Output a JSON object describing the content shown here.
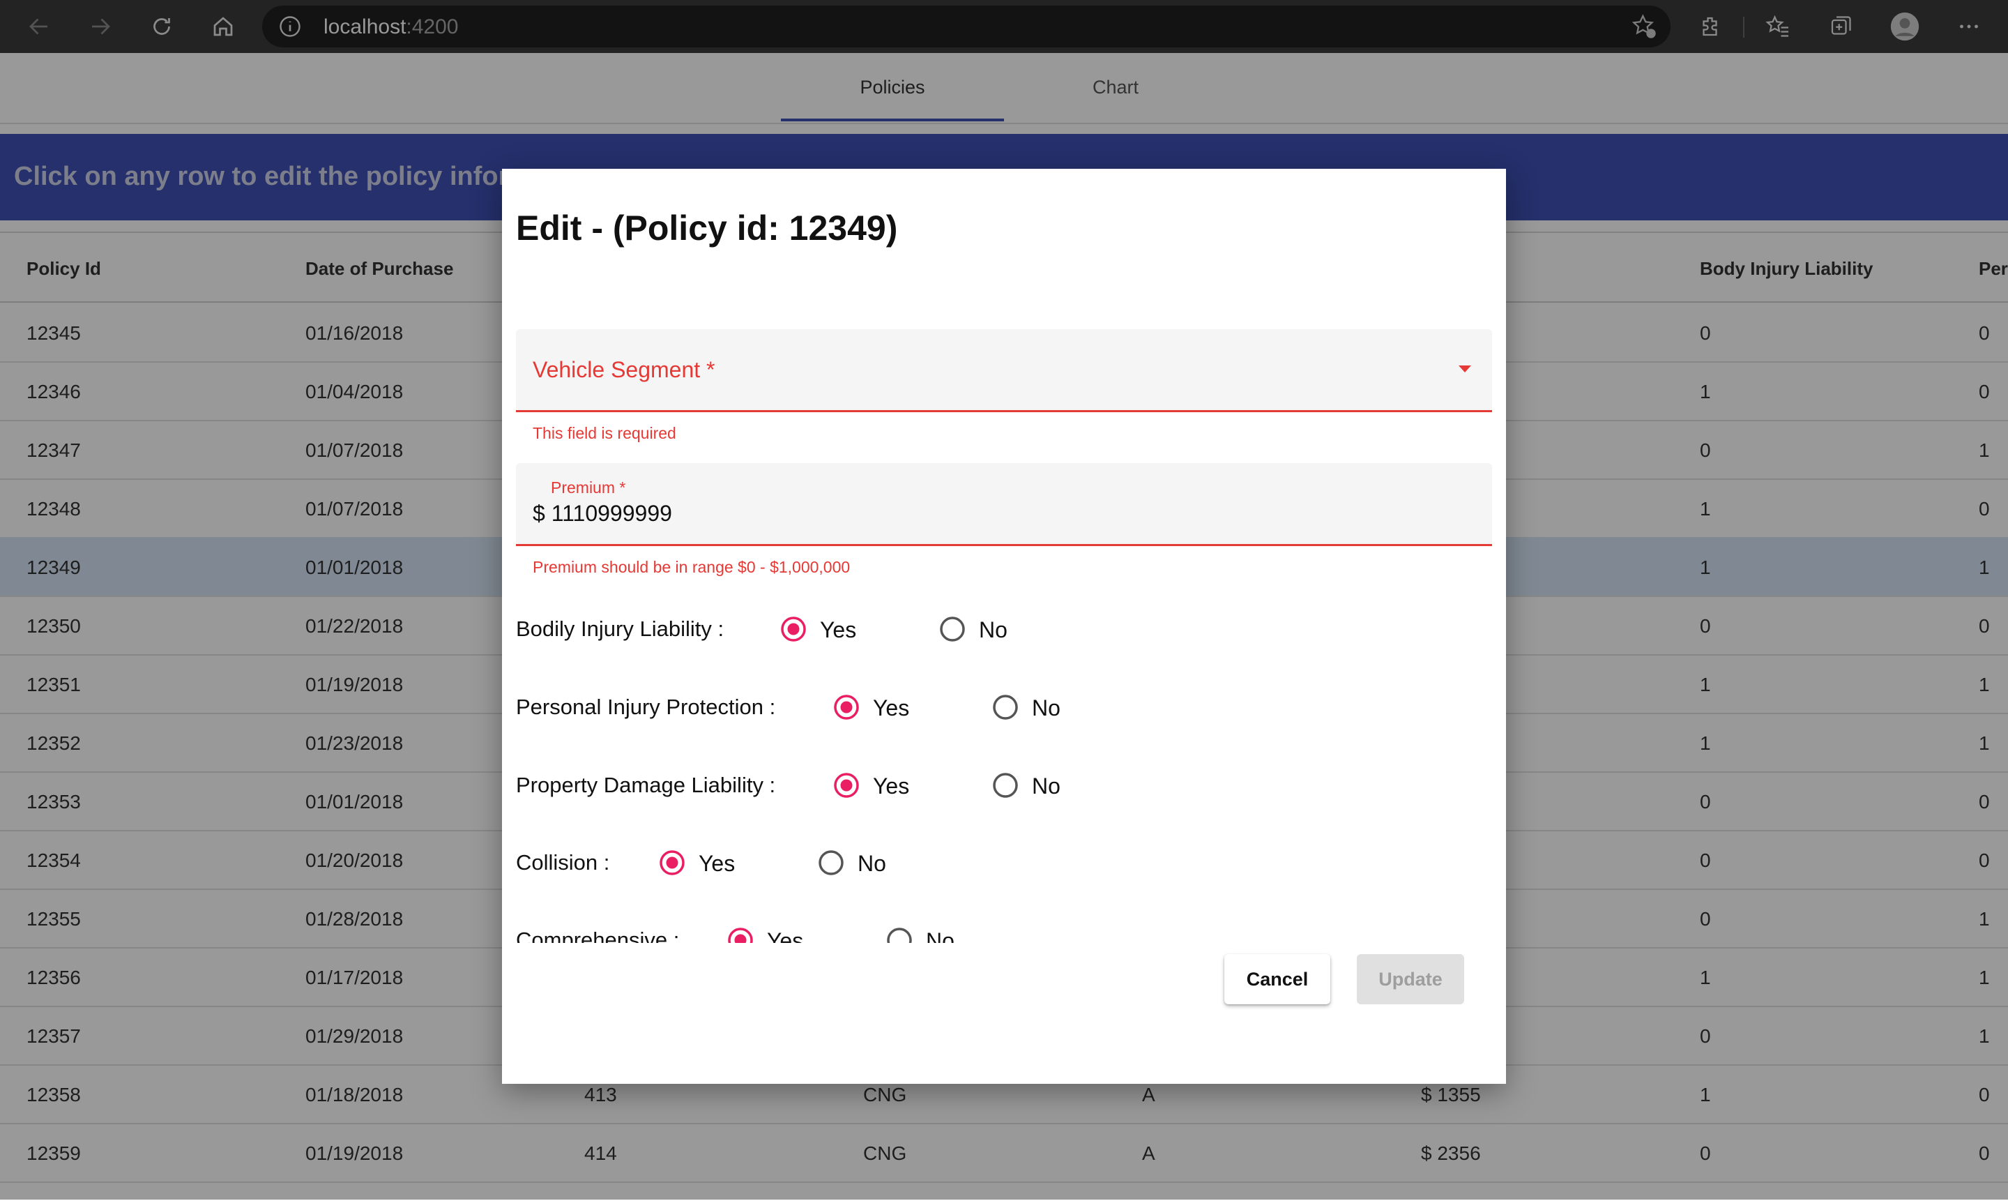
{
  "browser": {
    "url_host": "localhost",
    "url_port": ":4200"
  },
  "app": {
    "tabs": [
      {
        "label": "Policies",
        "active": true
      },
      {
        "label": "Chart",
        "active": false
      }
    ],
    "banner": "Click on any row to edit the policy informa",
    "table": {
      "headers": [
        "Policy Id",
        "Date of Purchase",
        "Body Injury Liability",
        "Per"
      ],
      "rows": [
        {
          "id": "12345",
          "date": "01/16/2018",
          "bil": "0",
          "per": "0"
        },
        {
          "id": "12346",
          "date": "01/04/2018",
          "bil": "1",
          "per": "0"
        },
        {
          "id": "12347",
          "date": "01/07/2018",
          "bil": "0",
          "per": "1"
        },
        {
          "id": "12348",
          "date": "01/07/2018",
          "bil": "1",
          "per": "0"
        },
        {
          "id": "12349",
          "date": "01/01/2018",
          "bil": "1",
          "per": "1"
        },
        {
          "id": "12350",
          "date": "01/22/2018",
          "bil": "0",
          "per": "0"
        },
        {
          "id": "12351",
          "date": "01/19/2018",
          "bil": "1",
          "per": "1"
        },
        {
          "id": "12352",
          "date": "01/23/2018",
          "bil": "1",
          "per": "1"
        },
        {
          "id": "12353",
          "date": "01/01/2018",
          "bil": "0",
          "per": "0"
        },
        {
          "id": "12354",
          "date": "01/20/2018",
          "bil": "0",
          "per": "0"
        },
        {
          "id": "12355",
          "date": "01/28/2018",
          "bil": "0",
          "per": "1"
        },
        {
          "id": "12356",
          "date": "01/17/2018",
          "bil": "1",
          "per": "1"
        },
        {
          "id": "12357",
          "date": "01/29/2018",
          "bil": "0",
          "per": "1"
        },
        {
          "id": "12358",
          "date": "01/18/2018",
          "c3": "413",
          "c4": "CNG",
          "c5": "A",
          "c6": "$ 1355",
          "bil": "1",
          "per": "0"
        },
        {
          "id": "12359",
          "date": "01/19/2018",
          "c3": "414",
          "c4": "CNG",
          "c5": "A",
          "c6": "$ 2356",
          "bil": "0",
          "per": "0"
        }
      ]
    }
  },
  "dialog": {
    "title": "Edit - (Policy id: 12349)",
    "vehicle_segment": {
      "label": "Vehicle Segment *",
      "error": "This field is required"
    },
    "premium": {
      "label": "Premium *",
      "value": "$ 1110999999",
      "error": "Premium should be in range $0 - $1,000,000"
    },
    "radios": [
      {
        "label": "Bodily Injury Liability :",
        "yes": "Yes",
        "no": "No",
        "selected": "Yes"
      },
      {
        "label": "Personal Injury Protection :",
        "yes": "Yes",
        "no": "No",
        "selected": "Yes"
      },
      {
        "label": "Property Damage Liability :",
        "yes": "Yes",
        "no": "No",
        "selected": "Yes"
      },
      {
        "label": "Collision :",
        "yes": "Yes",
        "no": "No",
        "selected": "Yes"
      },
      {
        "label": "Comprehensive :",
        "yes": "Yes",
        "no": "No",
        "selected": "Yes"
      }
    ],
    "cancel_label": "Cancel",
    "update_label": "Update"
  },
  "colors": {
    "accent": "#3f51b5",
    "error": "#e53935",
    "radio": "#e91e63"
  }
}
